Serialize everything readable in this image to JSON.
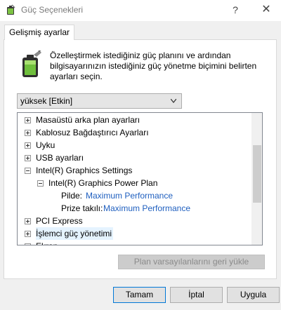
{
  "window": {
    "title": "Güç Seçenekleri",
    "help": "?",
    "close": "✕"
  },
  "tab": {
    "label": "Gelişmiş ayarlar"
  },
  "description": "Özelleştirmek istediğiniz güç planını ve ardından bilgisayarınızın istediğiniz güç yönetme biçimini belirten ayarları seçin.",
  "plan_select": {
    "value": "yüksek [Etkin]"
  },
  "tree": {
    "items": [
      {
        "label": "Masaüstü arka plan ayarları",
        "expander": "plus"
      },
      {
        "label": "Kablosuz Bağdaştırıcı Ayarları",
        "expander": "plus"
      },
      {
        "label": "Uyku",
        "expander": "plus"
      },
      {
        "label": "USB ayarları",
        "expander": "plus"
      },
      {
        "label": "Intel(R) Graphics Settings",
        "expander": "minus"
      },
      {
        "label": "Intel(R) Graphics Power Plan",
        "expander": "minus"
      },
      {
        "label": "Pilde:",
        "value": "Maximum Performance"
      },
      {
        "label": "Prize takılı:",
        "value": "Maximum Performance"
      },
      {
        "label": "PCI Express",
        "expander": "plus"
      },
      {
        "label": "İşlemci güç yönetimi",
        "expander": "plus"
      },
      {
        "label": "Ekran",
        "expander": "plus"
      }
    ]
  },
  "buttons": {
    "restore": "Plan varsayılanlarını geri yükle",
    "ok": "Tamam",
    "cancel": "İptal",
    "apply": "Uygula"
  },
  "colors": {
    "link_value": "#1f5fbf",
    "focus_border": "#0078d7"
  },
  "icons": {
    "title": "power-options-icon",
    "battery": "battery-plug-icon"
  }
}
